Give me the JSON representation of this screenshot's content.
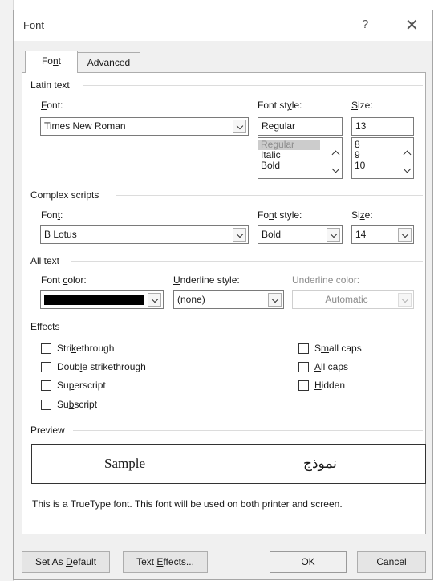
{
  "dialog": {
    "title": "Font",
    "help_glyph": "?",
    "close_glyph": "✕"
  },
  "tabs": [
    {
      "label_pre": "Fo",
      "label_u": "n",
      "label_post": "t",
      "active": true
    },
    {
      "label_pre": "Ad",
      "label_u": "v",
      "label_post": "anced",
      "active": false
    }
  ],
  "latin": {
    "group_label": "Latin text",
    "font_label_u": "F",
    "font_label_post": "ont:",
    "font_value": "Times New Roman",
    "style_label_pre": "Font st",
    "style_label_u": "y",
    "style_label_post": "le:",
    "style_value": "Regular",
    "style_options": [
      "Regular",
      "Italic",
      "Bold"
    ],
    "size_label_u": "S",
    "size_label_post": "ize:",
    "size_value": "13",
    "size_options": [
      "8",
      "9",
      "10"
    ]
  },
  "complex": {
    "group_label": "Complex scripts",
    "font_label_pre": "Fon",
    "font_label_u": "t",
    "font_label_post": ":",
    "font_value": "B Lotus",
    "style_label_pre": "Fo",
    "style_label_u": "n",
    "style_label_post": "t style:",
    "style_value": "Bold",
    "size_label_pre": "Si",
    "size_label_u": "z",
    "size_label_post": "e:",
    "size_value": "14"
  },
  "alltext": {
    "group_label": "All text",
    "color_label_pre": "Font ",
    "color_label_u": "c",
    "color_label_post": "olor:",
    "color_value": "#000000",
    "underline_label_u": "U",
    "underline_label_post": "nderline style:",
    "underline_value": "(none)",
    "ucolor_label": "Underline color:",
    "ucolor_value": "Automatic"
  },
  "effects": {
    "group_label": "Effects",
    "items": [
      {
        "pre": "Stri",
        "u": "k",
        "post": "ethrough",
        "checked": false
      },
      {
        "pre": "Doub",
        "u": "l",
        "post": "e strikethrough",
        "checked": false
      },
      {
        "pre": "Su",
        "u": "p",
        "post": "erscript",
        "checked": false
      },
      {
        "pre": "Su",
        "u": "b",
        "post": "script",
        "checked": false
      },
      {
        "pre": "S",
        "u": "m",
        "post": "all caps",
        "checked": false
      },
      {
        "pre": "",
        "u": "A",
        "post": "ll caps",
        "checked": false
      },
      {
        "pre": "",
        "u": "H",
        "post": "idden",
        "checked": false
      }
    ]
  },
  "preview": {
    "group_label": "Preview",
    "sample_text": "Sample",
    "sample_complex": "نموذج",
    "note": "This is a TrueType font. This font will be used on both printer and screen."
  },
  "buttons": {
    "set_default_pre": "Set As ",
    "set_default_u": "D",
    "set_default_post": "efault",
    "text_effects_pre": "Text ",
    "text_effects_u": "E",
    "text_effects_post": "ffects...",
    "ok": "OK",
    "cancel": "Cancel"
  }
}
